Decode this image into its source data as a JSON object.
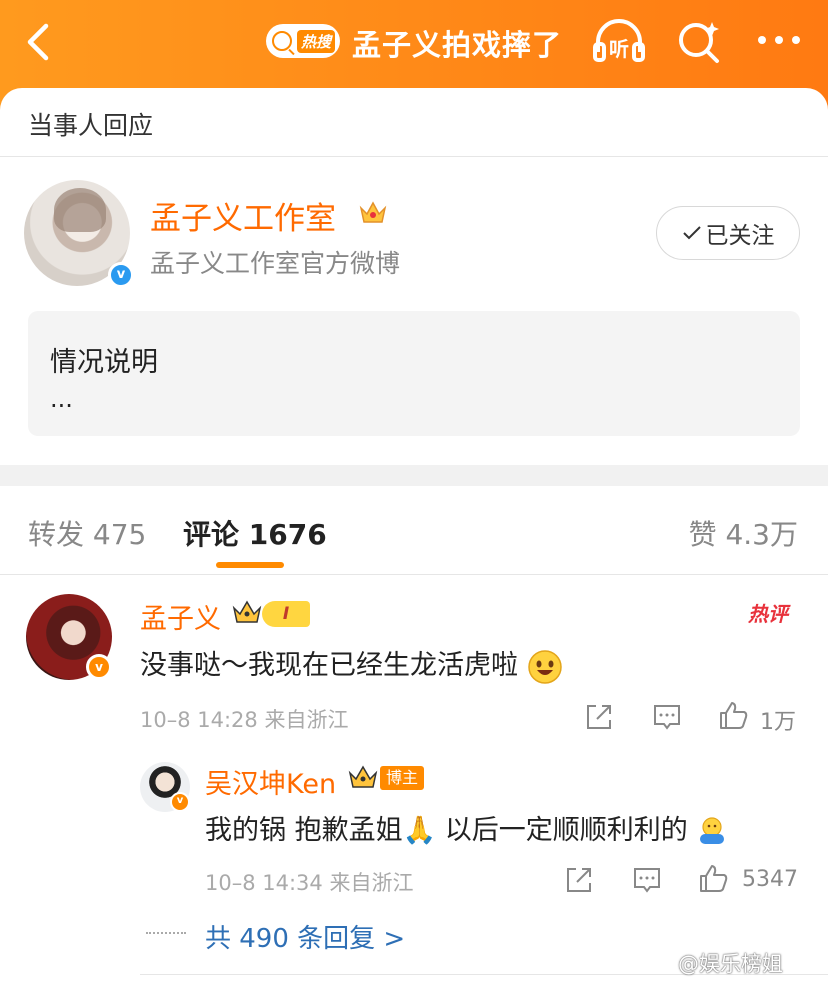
{
  "header": {
    "hot_label": "热搜",
    "title": "孟子义拍戏摔了",
    "listen_label": "听"
  },
  "section_title": "当事人回应",
  "post": {
    "author": "孟子义工作室",
    "author_desc": "孟子义工作室官方微博",
    "follow_label": "已关注",
    "quote_title": "情况说明",
    "quote_more": "..."
  },
  "tabs": {
    "repost": "转发 475",
    "comment": "评论 1676",
    "like": "赞 4.3万"
  },
  "comments": [
    {
      "name": "孟子义",
      "level": "I",
      "badge": "热评",
      "text": "没事哒～我现在已经生龙活虎啦",
      "meta": "10–8 14:28  来自浙江",
      "likes": "1万",
      "replies": [
        {
          "name": "吴汉坤Ken",
          "tag": "博主",
          "text": "我的锅 抱歉孟姐🙏 以后一定顺顺利利的",
          "meta": "10–8 14:34  来自浙江",
          "likes": "5347"
        }
      ],
      "more_replies": "共 490 条回复 >"
    }
  ],
  "watermark": "@娱乐榜姐",
  "colors": {
    "brand_orange": "#ff8a00",
    "name_orange": "#ff6a00",
    "link_blue": "#2e6fb5"
  }
}
